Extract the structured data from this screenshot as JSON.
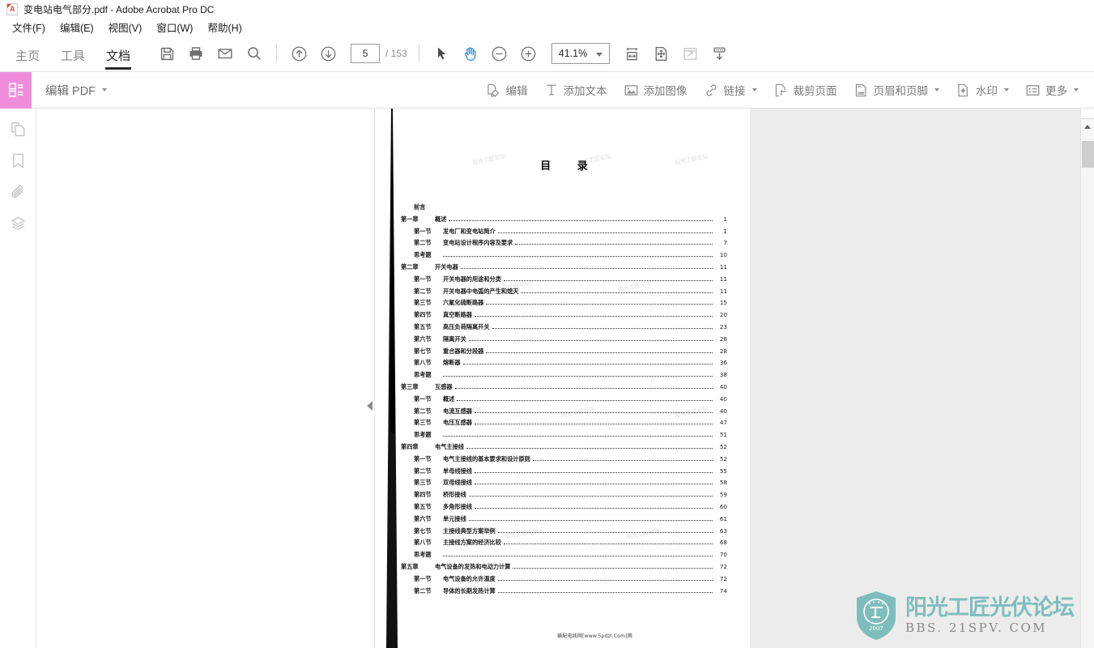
{
  "window": {
    "title": "变电站电气部分.pdf - Adobe Acrobat Pro DC",
    "app_icon": "pdf-file-icon"
  },
  "menubar": {
    "items": [
      {
        "label": "文件(F)",
        "name": "menu-file"
      },
      {
        "label": "编辑(E)",
        "name": "menu-edit"
      },
      {
        "label": "视图(V)",
        "name": "menu-view"
      },
      {
        "label": "窗口(W)",
        "name": "menu-window"
      },
      {
        "label": "帮助(H)",
        "name": "menu-help"
      }
    ]
  },
  "toolbar": {
    "tabs": [
      {
        "label": "主页",
        "active": false
      },
      {
        "label": "工具",
        "active": false
      },
      {
        "label": "文档",
        "active": true
      }
    ],
    "buttons": [
      {
        "name": "save-button",
        "icon": "save-icon"
      },
      {
        "name": "print-button",
        "icon": "print-icon"
      },
      {
        "name": "email-button",
        "icon": "envelope-icon"
      },
      {
        "name": "search-button",
        "icon": "search-icon"
      },
      {
        "name": "previous-page-button",
        "icon": "arrow-up-circle-icon"
      },
      {
        "name": "next-page-button",
        "icon": "arrow-down-circle-icon"
      },
      {
        "name": "select-tool-button",
        "icon": "cursor-arrow-icon"
      },
      {
        "name": "hand-tool-button",
        "icon": "hand-icon"
      },
      {
        "name": "zoom-out-button",
        "icon": "minus-circle-icon"
      },
      {
        "name": "zoom-in-button",
        "icon": "plus-circle-icon"
      },
      {
        "name": "fit-width-button",
        "icon": "fit-width-icon"
      },
      {
        "name": "fit-page-button",
        "icon": "fit-page-icon"
      },
      {
        "name": "fullscreen-button",
        "icon": "expand-icon"
      },
      {
        "name": "scroll-mode-button",
        "icon": "scroll-down-icon"
      }
    ],
    "page_number": "5",
    "page_total": "/ 153",
    "zoom_level": "41.1%"
  },
  "subtoolbar": {
    "panel_title": "编辑 PDF",
    "panel_icon": "edit-pdf-icon",
    "accent_color": "#ef8ddc",
    "tools": [
      {
        "label": "编辑",
        "icon": "edit-icon",
        "caret": false
      },
      {
        "label": "添加文本",
        "icon": "add-text-icon",
        "caret": false
      },
      {
        "label": "添加图像",
        "icon": "add-image-icon",
        "caret": false
      },
      {
        "label": "链接",
        "icon": "link-icon",
        "caret": true
      },
      {
        "label": "裁剪页面",
        "icon": "crop-page-icon",
        "caret": false
      },
      {
        "label": "页眉和页脚",
        "icon": "header-footer-icon",
        "caret": true
      },
      {
        "label": "水印",
        "icon": "watermark-icon",
        "caret": true
      },
      {
        "label": "更多",
        "icon": "more-icon",
        "caret": true
      }
    ]
  },
  "navrail": {
    "items": [
      {
        "name": "page-thumbnails-icon"
      },
      {
        "name": "bookmarks-icon"
      },
      {
        "name": "attachments-icon"
      },
      {
        "name": "layers-icon"
      }
    ]
  },
  "document": {
    "toc_title": "目 录",
    "footer_text": "输配电线网[www.5pdzl.Com]网",
    "watermark_text": "阳光工匠论坛",
    "entries": [
      {
        "level": "plain",
        "num": "前言",
        "text": "",
        "page": ""
      },
      {
        "level": "chapter",
        "num": "第一章",
        "text": "概述",
        "page": "1"
      },
      {
        "level": "section",
        "num": "第一节",
        "text": "发电厂和变电站简介",
        "page": "1"
      },
      {
        "level": "section",
        "num": "第二节",
        "text": "变电站设计程序内容及要求",
        "page": "7"
      },
      {
        "level": "plain",
        "num": "思考题",
        "text": "",
        "page": "10"
      },
      {
        "level": "chapter",
        "num": "第二章",
        "text": "开关电器",
        "page": "11"
      },
      {
        "level": "section",
        "num": "第一节",
        "text": "开关电器的用途和分类",
        "page": "11"
      },
      {
        "level": "section",
        "num": "第二节",
        "text": "开关电器中电弧的产生和熄灭",
        "page": "11"
      },
      {
        "level": "section",
        "num": "第三节",
        "text": "六氟化硫断路器",
        "page": "15"
      },
      {
        "level": "section",
        "num": "第四节",
        "text": "真空断路器",
        "page": "20"
      },
      {
        "level": "section",
        "num": "第五节",
        "text": "高压负荷隔离开关",
        "page": "23"
      },
      {
        "level": "section",
        "num": "第六节",
        "text": "隔离开关",
        "page": "28"
      },
      {
        "level": "section",
        "num": "第七节",
        "text": "重合器和分段器",
        "page": "28"
      },
      {
        "level": "section",
        "num": "第八节",
        "text": "熔断器",
        "page": "36"
      },
      {
        "level": "plain",
        "num": "思考题",
        "text": "",
        "page": "38"
      },
      {
        "level": "chapter",
        "num": "第三章",
        "text": "互感器",
        "page": "40"
      },
      {
        "level": "section",
        "num": "第一节",
        "text": "概述",
        "page": "40"
      },
      {
        "level": "section",
        "num": "第二节",
        "text": "电流互感器",
        "page": "40"
      },
      {
        "level": "section",
        "num": "第三节",
        "text": "电压互感器",
        "page": "47"
      },
      {
        "level": "plain",
        "num": "思考题",
        "text": "",
        "page": "51"
      },
      {
        "level": "chapter",
        "num": "第四章",
        "text": "电气主接线",
        "page": "52"
      },
      {
        "level": "section",
        "num": "第一节",
        "text": "电气主接线的基本要求和设计原则",
        "page": "52"
      },
      {
        "level": "section",
        "num": "第二节",
        "text": "单母线接线",
        "page": "55"
      },
      {
        "level": "section",
        "num": "第三节",
        "text": "双母线接线",
        "page": "58"
      },
      {
        "level": "section",
        "num": "第四节",
        "text": "桥形接线",
        "page": "59"
      },
      {
        "level": "section",
        "num": "第五节",
        "text": "多角形接线",
        "page": "60"
      },
      {
        "level": "section",
        "num": "第六节",
        "text": "单元接线",
        "page": "61"
      },
      {
        "level": "section",
        "num": "第七节",
        "text": "主接线典型方案举例",
        "page": "63"
      },
      {
        "level": "section",
        "num": "第八节",
        "text": "主接线方案的经济比较",
        "page": "68"
      },
      {
        "level": "plain",
        "num": "思考题",
        "text": "",
        "page": "70"
      },
      {
        "level": "chapter",
        "num": "第五章",
        "text": "电气设备的发热和电动力计算",
        "page": "72"
      },
      {
        "level": "section",
        "num": "第一节",
        "text": "电气设备的允许温度",
        "page": "72"
      },
      {
        "level": "section",
        "num": "第二节",
        "text": "导体的长期发热计算",
        "page": "74"
      }
    ]
  },
  "forum_watermark": {
    "chinese": "阳光工匠光伏论坛",
    "english": "BBS. 21SPV. COM",
    "shield_year": "2007",
    "shield_color": "#7fbdbd"
  },
  "scrollbar": {
    "name": "vertical-scrollbar"
  }
}
